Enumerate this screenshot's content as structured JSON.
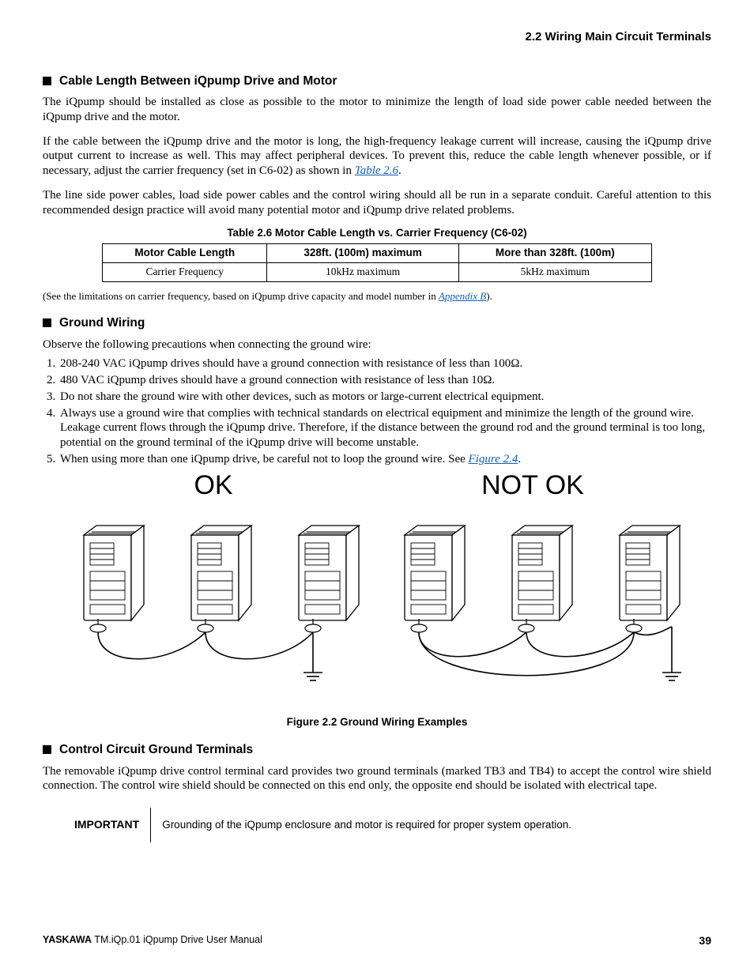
{
  "header": {
    "section": "2.2  Wiring Main Circuit Terminals"
  },
  "s1": {
    "heading": "Cable Length Between iQpump Drive and Motor",
    "p1": "The iQpump should be installed as close as possible to the motor to minimize the length of load side power cable needed between the iQpump drive and the motor.",
    "p2a": "If the cable between the iQpump drive and the motor is long, the high-frequency leakage current will increase, causing the iQpump drive output current to increase as well. This may affect peripheral devices. To prevent this, reduce the cable length whenever possible, or if necessary, adjust the carrier frequency (set in C6-02) as shown in ",
    "p2link": "Table 2.6",
    "p2b": ".",
    "p3": "The line side power cables, load side power cables and the control wiring should all be run in a separate conduit. Careful attention to this recommended design practice will avoid many potential motor and iQpump drive related problems."
  },
  "table": {
    "caption": "Table 2.6  Motor Cable Length vs. Carrier Frequency (C6-02)",
    "headers": [
      "Motor Cable Length",
      "328ft. (100m) maximum",
      "More than 328ft. (100m)"
    ],
    "row": [
      "Carrier Frequency",
      "10kHz maximum",
      "5kHz maximum"
    ],
    "note_a": "(See the limitations on carrier frequency, based on iQpump drive capacity and model number in ",
    "note_link": "Appendix B",
    "note_b": ")."
  },
  "s2": {
    "heading": "Ground Wiring",
    "intro": "Observe the following precautions when connecting the ground wire:",
    "items": [
      "208-240 VAC iQpump drives should have a ground connection with resistance of less than 100Ω.",
      "480 VAC iQpump drives should have a ground connection with resistance of less than 10Ω.",
      "Do not share the ground wire with other devices, such as motors or large-current electrical equipment.",
      "Always use a ground wire that complies with technical standards on electrical equipment and minimize the length of the ground wire. Leakage current flows through the iQpump drive. Therefore, if the distance between the ground rod and the ground terminal is too long, potential on the ground terminal of the iQpump drive will become unstable.",
      "When using more than one iQpump drive, be careful not to loop the ground wire. See "
    ],
    "item5_link": "Figure 2.4",
    "item5_tail": "."
  },
  "diagram": {
    "ok": "OK",
    "notok": "NOT OK",
    "caption": "Figure 2.2  Ground Wiring Examples"
  },
  "s3": {
    "heading": "Control Circuit Ground Terminals",
    "p1": "The removable iQpump drive control terminal card provides two ground terminals (marked TB3 and TB4) to accept the control wire shield connection. The control wire shield should be connected on this end only, the opposite end should be isolated with electrical tape."
  },
  "important": {
    "label": "IMPORTANT",
    "text": "Grounding of the iQpump enclosure and motor is required for proper system operation."
  },
  "footer": {
    "brand": "YASKAWA",
    "doc": " TM.iQp.01 iQpump Drive User Manual",
    "page": "39"
  }
}
